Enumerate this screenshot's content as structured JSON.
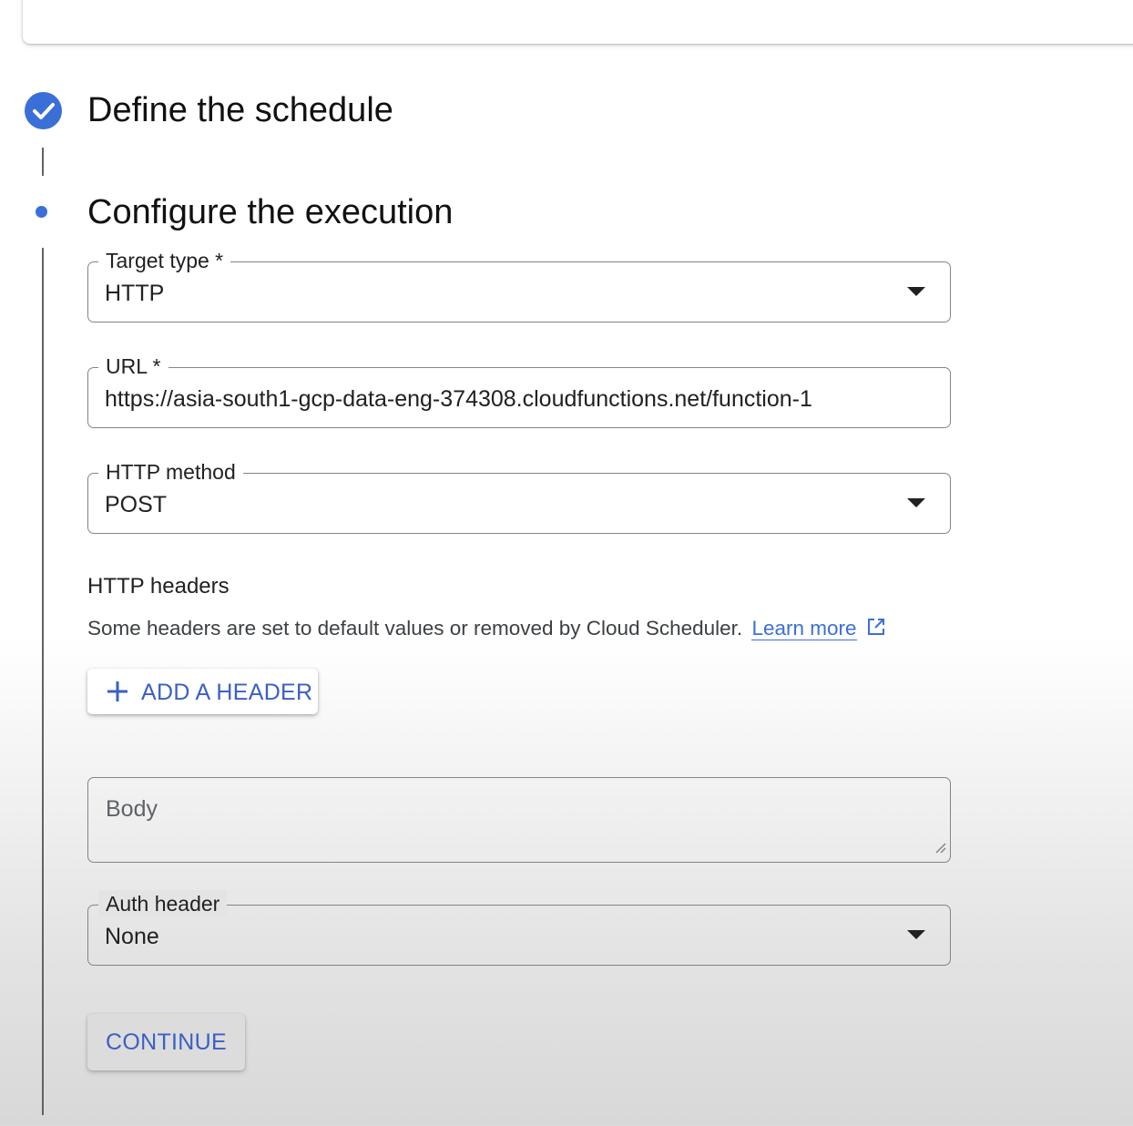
{
  "steps": {
    "schedule": {
      "title": "Define the schedule",
      "status": "completed"
    },
    "execution": {
      "title": "Configure the execution",
      "status": "active"
    }
  },
  "form": {
    "target_type": {
      "label": "Target type *",
      "value": "HTTP"
    },
    "url": {
      "label": "URL *",
      "value": "https://asia-south1-gcp-data-eng-374308.cloudfunctions.net/function-1"
    },
    "http_method": {
      "label": "HTTP method",
      "value": "POST"
    },
    "headers": {
      "title": "HTTP headers",
      "description": "Some headers are set to default values or removed by Cloud Scheduler.",
      "link_label": "Learn more",
      "add_button": "ADD A HEADER"
    },
    "body": {
      "placeholder": "Body"
    },
    "auth_header": {
      "label": "Auth header",
      "value": "None"
    }
  },
  "actions": {
    "continue_label": "CONTINUE"
  },
  "colors": {
    "accent": "#3b6fd8",
    "button_text": "#3b5fc4"
  }
}
